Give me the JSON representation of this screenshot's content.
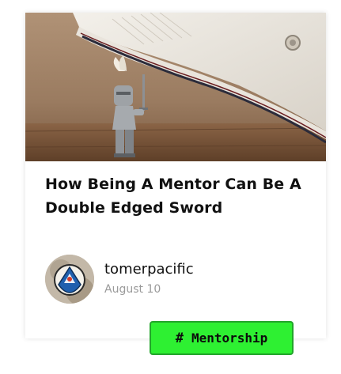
{
  "post": {
    "title": "How Being A Mentor Can Be A Double Edged Sword",
    "author_name": "tomerpacific",
    "date": "August 10",
    "tag_label": "Mentorship",
    "tag_icon": "#"
  },
  "colors": {
    "tag_background": "#2ef032",
    "tag_border": "#22a52a",
    "title": "#111111",
    "date": "#9a9a9a"
  }
}
